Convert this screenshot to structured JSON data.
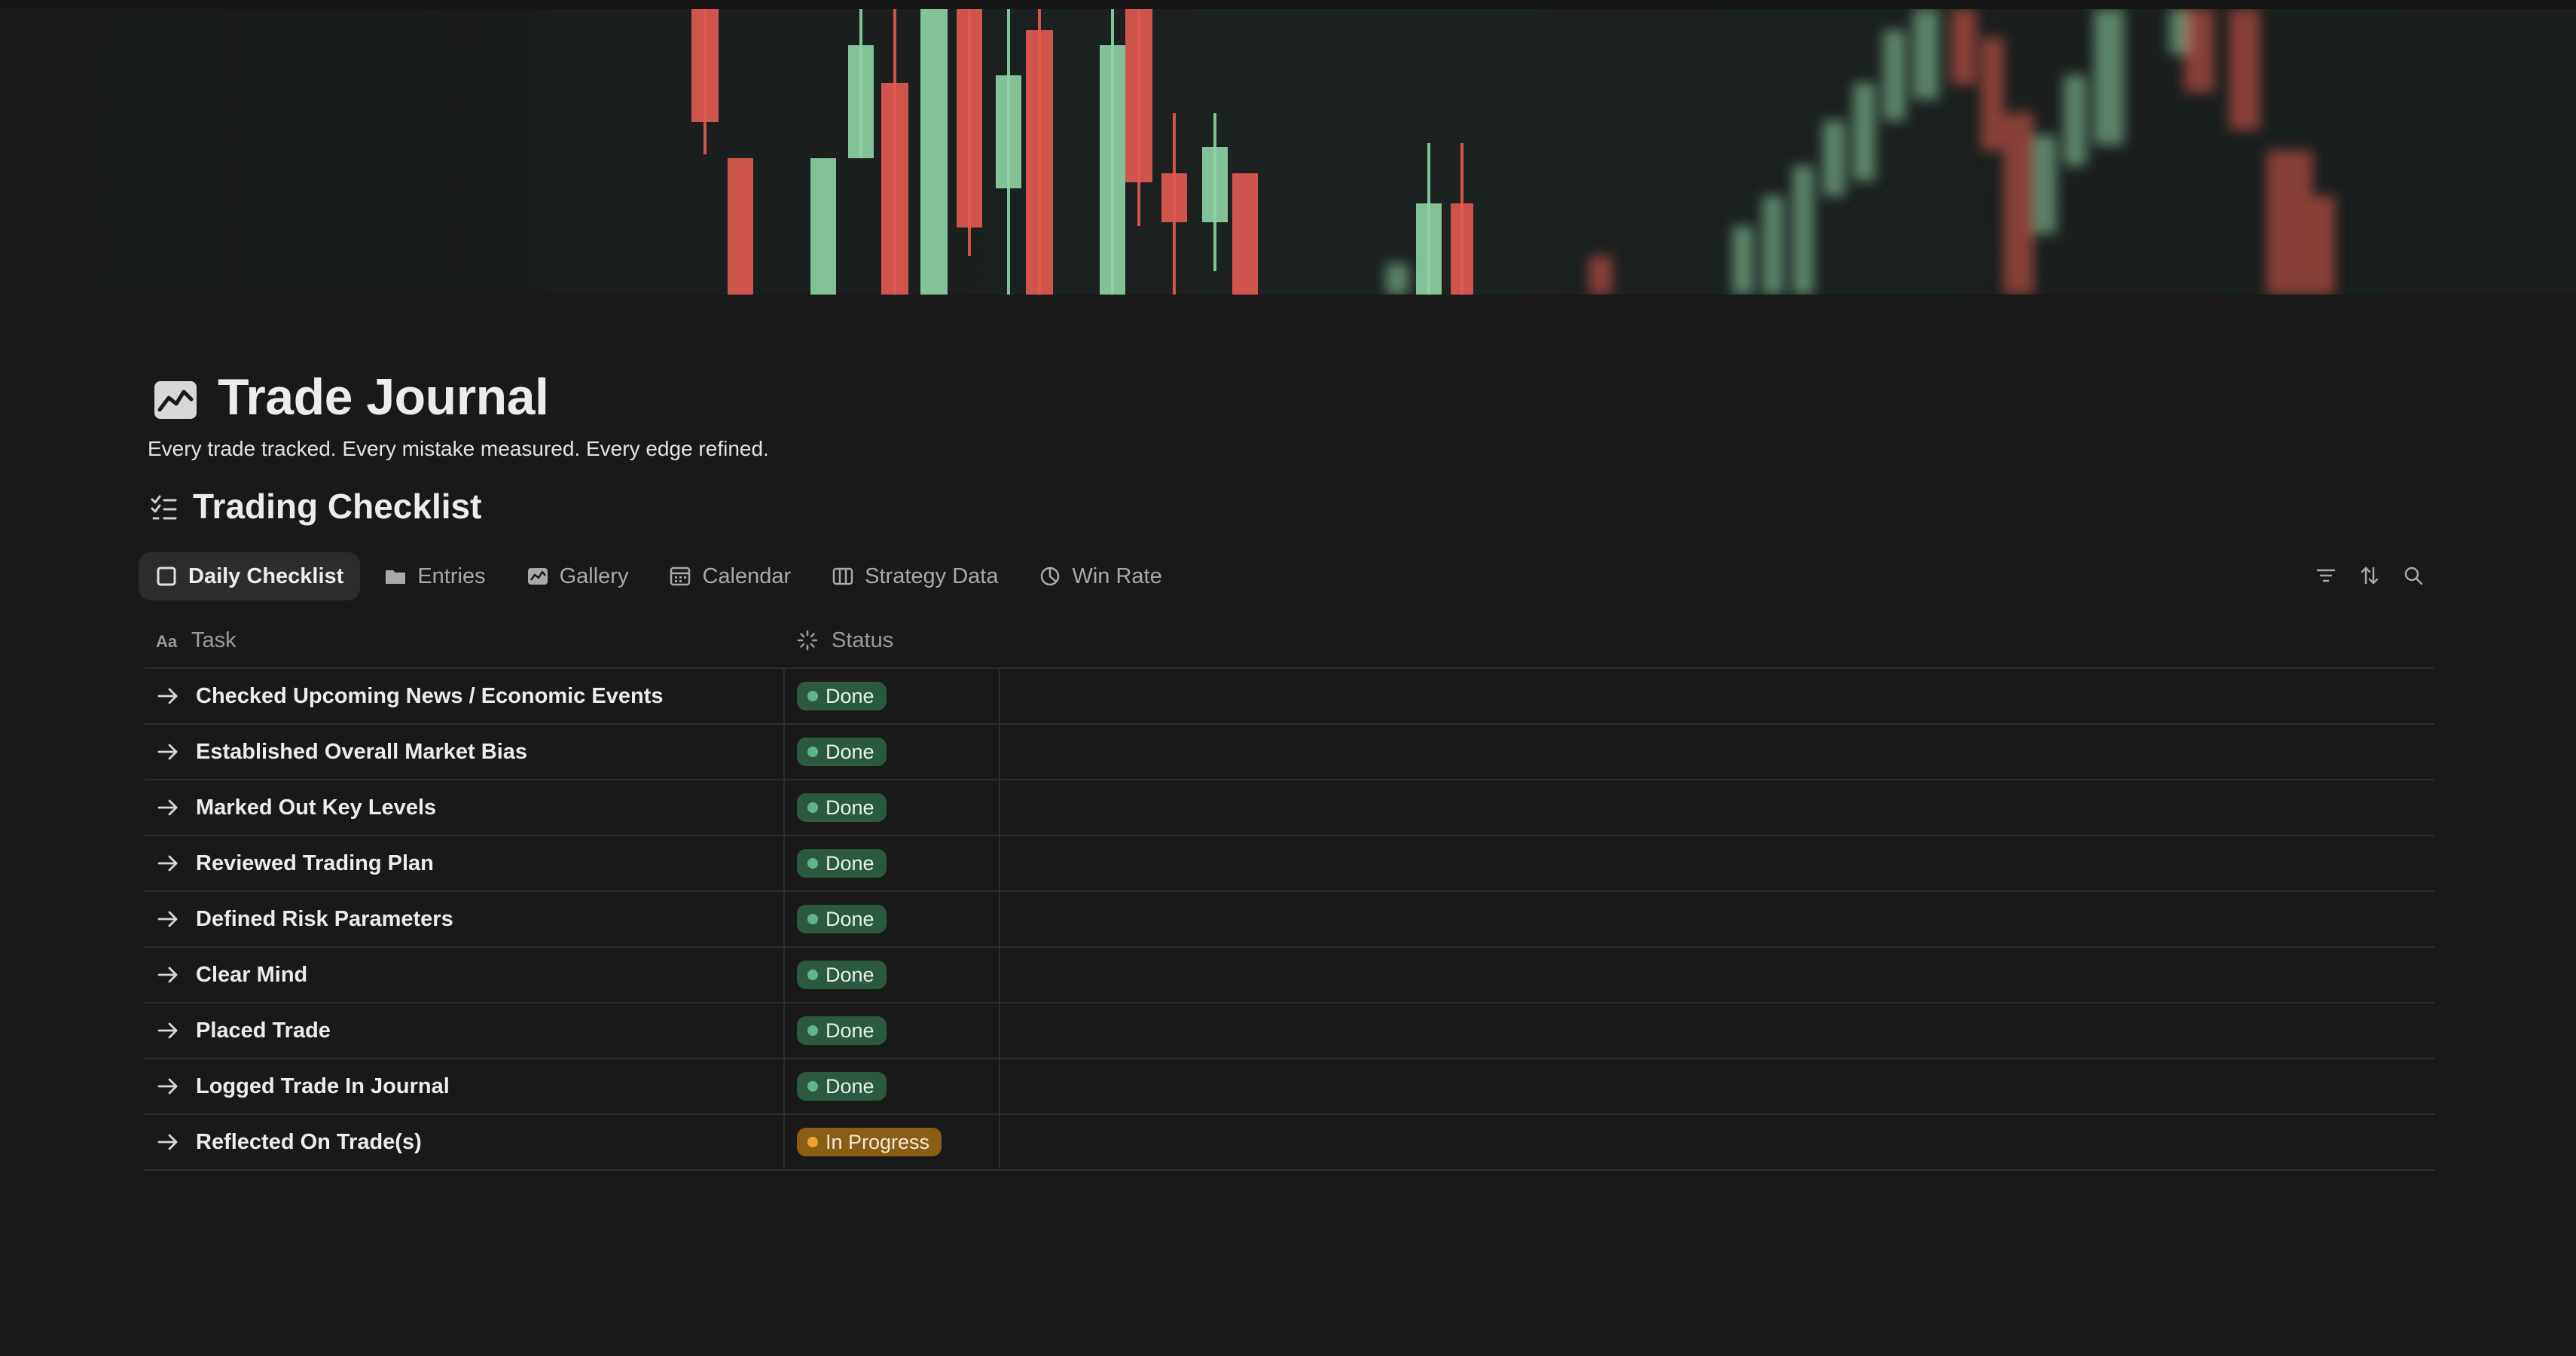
{
  "page": {
    "title": "Trade Journal",
    "icon": "chart-icon",
    "description": "Every trade tracked. Every mistake measured. Every edge refined."
  },
  "database": {
    "title": "Trading Checklist",
    "icon": "checklist-icon"
  },
  "tabs": [
    {
      "label": "Daily Checklist",
      "icon": "checkbox-icon",
      "active": true
    },
    {
      "label": "Entries",
      "icon": "folder-icon",
      "active": false
    },
    {
      "label": "Gallery",
      "icon": "chart-icon",
      "active": false
    },
    {
      "label": "Calendar",
      "icon": "calendar-icon",
      "active": false
    },
    {
      "label": "Strategy Data",
      "icon": "columns-icon",
      "active": false
    },
    {
      "label": "Win Rate",
      "icon": "pie-icon",
      "active": false
    }
  ],
  "toolbar": [
    "filter-icon",
    "sort-icon",
    "search-icon"
  ],
  "table": {
    "columns": [
      {
        "label": "Task",
        "icon": "text-icon"
      },
      {
        "label": "Status",
        "icon": "status-icon"
      }
    ],
    "rows": [
      {
        "task": "Checked Upcoming News / Economic Events",
        "status": "Done"
      },
      {
        "task": "Established Overall Market Bias",
        "status": "Done"
      },
      {
        "task": "Marked Out Key Levels",
        "status": "Done"
      },
      {
        "task": "Reviewed Trading Plan",
        "status": "Done"
      },
      {
        "task": "Defined Risk Parameters",
        "status": "Done"
      },
      {
        "task": "Clear Mind",
        "status": "Done"
      },
      {
        "task": "Placed Trade",
        "status": "Done"
      },
      {
        "task": "Logged Trade In Journal",
        "status": "Done"
      },
      {
        "task": "Reflected On Trade(s)",
        "status": "In Progress"
      }
    ]
  },
  "colors": {
    "background": "#191919",
    "done_badge": "#2b5a40",
    "in_progress_badge": "#8a5d15",
    "candle_up": "#8fd3a6",
    "candle_down": "#e35a50"
  }
}
